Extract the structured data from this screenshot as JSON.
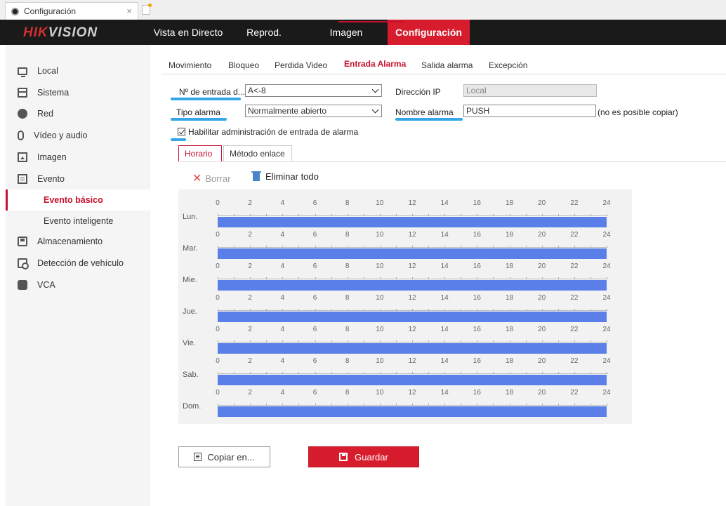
{
  "browser": {
    "tab_title": "Configuración",
    "close_glyph": "×"
  },
  "brand": {
    "logo_part1": "HIK",
    "logo_part2": "VISION"
  },
  "topnav": {
    "items": [
      {
        "label": "Vista en Directo"
      },
      {
        "label": "Reprod."
      },
      {
        "label": "Imagen"
      },
      {
        "label": "Configuración",
        "active": true
      }
    ]
  },
  "sidebar": {
    "items": [
      {
        "label": "Local",
        "icon": "monitor-icon"
      },
      {
        "label": "Sistema",
        "icon": "system-icon"
      },
      {
        "label": "Red",
        "icon": "globe-icon"
      },
      {
        "label": "Vídeo y audio",
        "icon": "microphone-icon"
      },
      {
        "label": "Imagen",
        "icon": "image-icon"
      },
      {
        "label": "Evento",
        "icon": "calendar-icon"
      },
      {
        "label": "Evento básico",
        "active": true
      },
      {
        "label": "Evento inteligente"
      },
      {
        "label": "Almacenamiento",
        "icon": "storage-icon"
      },
      {
        "label": "Detección de vehículo",
        "icon": "vehicle-icon"
      },
      {
        "label": "VCA",
        "icon": "vca-icon"
      }
    ]
  },
  "subtabs": {
    "items": [
      {
        "label": "Movimiento"
      },
      {
        "label": "Bloqueo"
      },
      {
        "label": "Perdida Video"
      },
      {
        "label": "Entrada Alarma",
        "active": true
      },
      {
        "label": "Salida alarma"
      },
      {
        "label": "Excepción"
      }
    ]
  },
  "form": {
    "input_no_label": "Nº de entrada d...",
    "input_no_value": "A<-8",
    "ip_label": "Dirección IP",
    "ip_value": "Local",
    "alarm_type_label": "Tipo alarma",
    "alarm_type_value": "Normalmente abierto",
    "alarm_name_label": "Nombre alarma",
    "alarm_name_value": "PUSH",
    "alarm_name_note": "(no es posible copiar)",
    "enable_label": "Habilitar administración de entrada de alarma",
    "enable_checked": true,
    "highlight_color": "#35a7e8"
  },
  "schedule_tabs": {
    "schedule_label": "Horario",
    "linkage_label": "Método enlace"
  },
  "toolbar": {
    "delete_label": "Borrar",
    "delete_all_label": "Eliminar todo"
  },
  "schedule": {
    "ticks": [
      "0",
      "2",
      "4",
      "6",
      "8",
      "10",
      "12",
      "14",
      "16",
      "18",
      "20",
      "22",
      "24"
    ],
    "days": [
      {
        "label": "Lun.",
        "from": 0,
        "to": 24
      },
      {
        "label": "Mar.",
        "from": 0,
        "to": 24
      },
      {
        "label": "Mie.",
        "from": 0,
        "to": 24
      },
      {
        "label": "Jue.",
        "from": 0,
        "to": 24
      },
      {
        "label": "Vie.",
        "from": 0,
        "to": 24
      },
      {
        "label": "Sab.",
        "from": 0,
        "to": 24
      },
      {
        "label": "Dom.",
        "from": 0,
        "to": 24
      }
    ],
    "bar_color": "#5a7fe8"
  },
  "buttons": {
    "copy_label": "Copiar en...",
    "save_label": "Guardar"
  }
}
